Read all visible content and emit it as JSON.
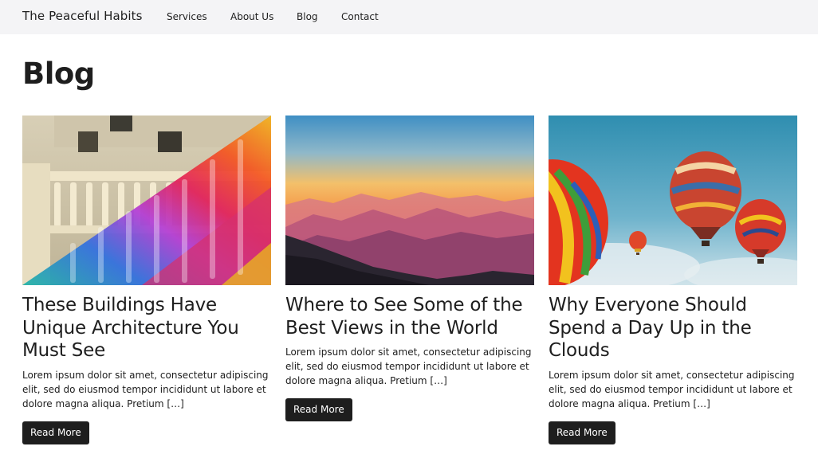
{
  "header": {
    "brand": "The Peaceful Habits",
    "nav": [
      "Services",
      "About Us",
      "Blog",
      "Contact"
    ]
  },
  "page": {
    "title": "Blog"
  },
  "posts": [
    {
      "image": "colorful-balustrade-architecture-photo",
      "title": "These Buildings Have Unique Architecture You Must See",
      "excerpt": "Lorem ipsum dolor sit amet, consectetur adipiscing elit, sed do eiusmod tempor incididunt ut labore et dolore magna aliqua. Pretium […]",
      "button": "Read More"
    },
    {
      "image": "sunset-mountain-landscape-photo",
      "title": "Where to See Some of the Best Views in the World",
      "excerpt": "Lorem ipsum dolor sit amet, consectetur adipiscing elit, sed do eiusmod tempor incididunt ut labore et dolore magna aliqua. Pretium […]",
      "button": "Read More"
    },
    {
      "image": "hot-air-balloons-sky-photo",
      "title": "Why Everyone Should Spend a Day Up in the Clouds",
      "excerpt": "Lorem ipsum dolor sit amet, consectetur adipiscing elit, sed do eiusmod tempor incididunt ut labore et dolore magna aliqua. Pretium […]",
      "button": "Read More"
    }
  ],
  "colors": {
    "text": "#1e1e1e",
    "header_bg": "#f4f4f6",
    "button_bg": "#1e1e1e",
    "button_text": "#ffffff"
  }
}
